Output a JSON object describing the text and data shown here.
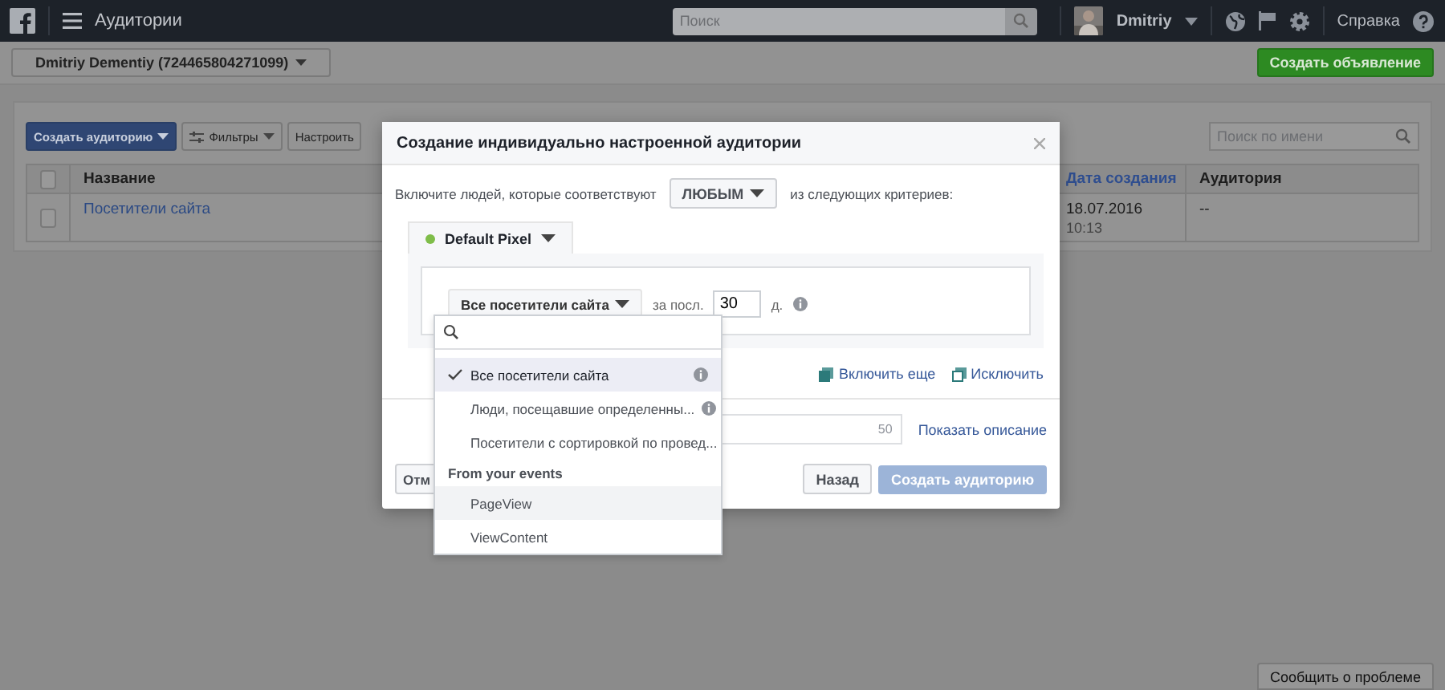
{
  "top_bar": {
    "title": "Аудитории",
    "search": {
      "placeholder": "Поиск"
    },
    "user": "Dmitriy",
    "help": "Справка"
  },
  "account_bar": {
    "account": "Dmitriy Dementiy (724465804271099)",
    "create_ad": "Создать объявление"
  },
  "toolbar": {
    "create_audience": "Создать аудиторию",
    "filters": "Фильтры",
    "customize": "Настроить",
    "search": {
      "placeholder": "Поиск по имени"
    }
  },
  "table": {
    "all_selected": false,
    "columns": [
      {
        "label": "Название",
        "sorted": false
      },
      {
        "label": "Дата создания",
        "sorted": true
      },
      {
        "label": "Аудитория",
        "sorted": false
      }
    ],
    "rows": [
      {
        "selected": false,
        "name": "Посетители сайта",
        "date": "18.07.2016",
        "time": "10:13",
        "audience": "--"
      }
    ]
  },
  "dialog": {
    "title": "Создание индивидуально настроенной аудитории",
    "include_prefix": "Включите людей, которые соответствуют",
    "match": "ЛЮБЫМ",
    "include_suffix": "из следующих критериев:",
    "pixel": {
      "name": "Default Pixel",
      "active": true
    },
    "rule": {
      "source": "Все посетители сайта",
      "period_label": "за посл.",
      "days": "30",
      "days_unit": "д."
    },
    "include_more": "Включить еще",
    "exclude": "Исключить",
    "name_counter": "50",
    "show_description": "Показать описание",
    "buttons": [
      {
        "label": "Отм",
        "kind": "secondary",
        "disabled": false
      },
      {
        "label": "Назад",
        "kind": "secondary",
        "disabled": false
      },
      {
        "label": "Создать аудиторию",
        "kind": "primary",
        "disabled": true
      }
    ]
  },
  "dropdown": {
    "items": [
      {
        "kind": "option",
        "label": "Все посетители сайта",
        "selected": true,
        "info": true
      },
      {
        "kind": "option",
        "label": "Люди, посещавшие определенны...",
        "selected": false,
        "info": true
      },
      {
        "kind": "option",
        "label": "Посетители с сортировкой по провед...",
        "selected": false
      },
      {
        "kind": "header",
        "label": "From your events"
      },
      {
        "kind": "event",
        "label": "PageView",
        "highlighted": true
      },
      {
        "kind": "event",
        "label": "ViewContent",
        "highlighted": false
      }
    ]
  },
  "report_button": "Сообщить о проблеме"
}
